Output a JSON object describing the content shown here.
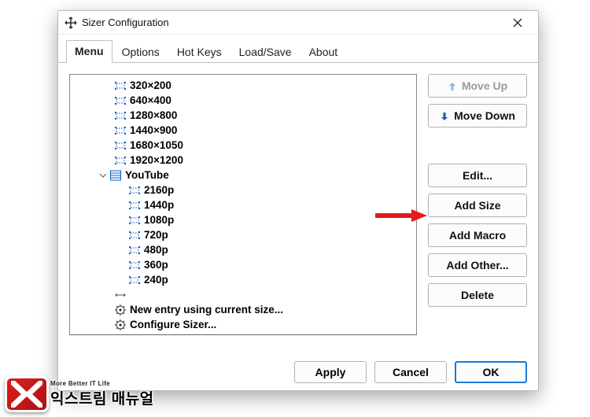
{
  "window": {
    "title": "Sizer Configuration"
  },
  "tabs": [
    {
      "label": "Menu",
      "active": true
    },
    {
      "label": "Options",
      "active": false
    },
    {
      "label": "Hot Keys",
      "active": false
    },
    {
      "label": "Load/Save",
      "active": false
    },
    {
      "label": "About",
      "active": false
    }
  ],
  "tree": {
    "sizes": [
      "320×200",
      "640×400",
      "1280×800",
      "1440×900",
      "1680×1050",
      "1920×1200"
    ],
    "folder": {
      "name": "YouTube",
      "items": [
        "2160p",
        "1440p",
        "1080p",
        "720p",
        "480p",
        "360p",
        "240p"
      ]
    },
    "actions": [
      "New entry using current size...",
      "Configure Sizer..."
    ]
  },
  "side": {
    "moveUp": "Move Up",
    "moveDown": "Move Down",
    "edit": "Edit...",
    "addSize": "Add Size",
    "addMacro": "Add Macro",
    "addOther": "Add Other...",
    "delete": "Delete"
  },
  "bottom": {
    "apply": "Apply",
    "cancel": "Cancel",
    "ok": "OK"
  },
  "watermark": {
    "sub": "More Better IT Life",
    "main": "익스트림 매뉴얼"
  }
}
